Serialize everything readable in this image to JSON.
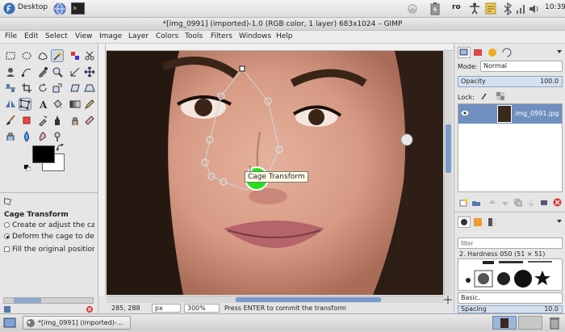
{
  "top_panel": {
    "menu_label": "Desktop",
    "keyboard_layout": "ro",
    "clock": "10:39"
  },
  "window": {
    "title": "*[img_0991] (imported)-1.0 (RGB color, 1 layer) 683x1024 – GIMP"
  },
  "menubar": {
    "items": [
      "File",
      "Edit",
      "Select",
      "View",
      "Image",
      "Layer",
      "Colors",
      "Tools",
      "Filters",
      "Windows",
      "Help"
    ]
  },
  "tool_options": {
    "title": "Cage Transform",
    "option_create": "Create or adjust the cage",
    "option_deform": "Deform the cage to deform",
    "option_fill": "Fill the original position of"
  },
  "canvas": {
    "tooltip": "Cage Transform"
  },
  "statusbar": {
    "coords": "285, 288",
    "unit": "px",
    "zoom": "300%",
    "message": "Press ENTER to commit the transform"
  },
  "layers": {
    "mode_label": "Mode:",
    "mode_value": "Normal",
    "opacity_label": "Opacity",
    "opacity_value": "100.0",
    "lock_label": "Lock:",
    "layer_name": "img_0991.jpg"
  },
  "brushes": {
    "filter_placeholder": "filter",
    "brush_name": "2. Hardness 050 (51 × 51)",
    "preset": "Basic.",
    "spacing_label": "Spacing",
    "spacing_value": "10.0"
  },
  "taskbar": {
    "task_label": "*[img_0991] (imported)-..."
  },
  "colors": {
    "accent": "#6f8fbf",
    "cage_handle": "#22e01a"
  }
}
